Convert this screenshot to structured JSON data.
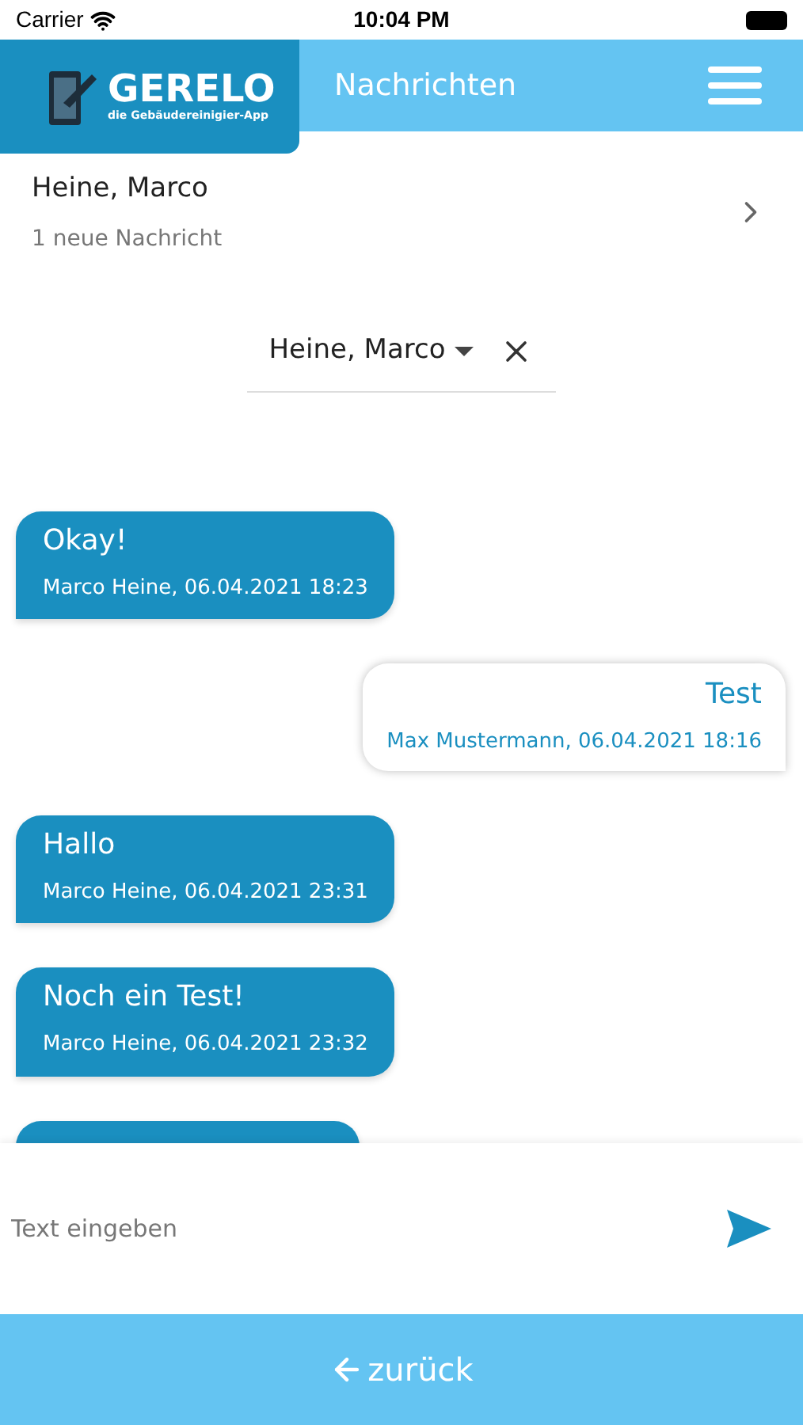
{
  "status_bar": {
    "carrier": "Carrier",
    "time": "10:04 PM"
  },
  "header": {
    "logo_name": "GERELO",
    "logo_tagline": "die Gebäudereinigier-App",
    "title": "Nachrichten"
  },
  "contact": {
    "name": "Heine, Marco",
    "subtitle": "1 neue Nachricht"
  },
  "recipient_select": {
    "value": "Heine, Marco"
  },
  "messages": [
    {
      "kind": "incoming",
      "text": "Okay!",
      "meta": "Marco Heine, 06.04.2021 18:23"
    },
    {
      "kind": "outgoing",
      "text": "Test",
      "meta": "Max Mustermann, 06.04.2021 18:16"
    },
    {
      "kind": "incoming",
      "text": "Hallo",
      "meta": "Marco Heine, 06.04.2021 23:31"
    },
    {
      "kind": "incoming",
      "text": "Noch ein Test!",
      "meta": "Marco Heine, 06.04.2021 23:32"
    },
    {
      "kind": "incoming"
    }
  ],
  "composer": {
    "placeholder": "Text eingeben"
  },
  "back_button": {
    "label": "zurück"
  }
}
